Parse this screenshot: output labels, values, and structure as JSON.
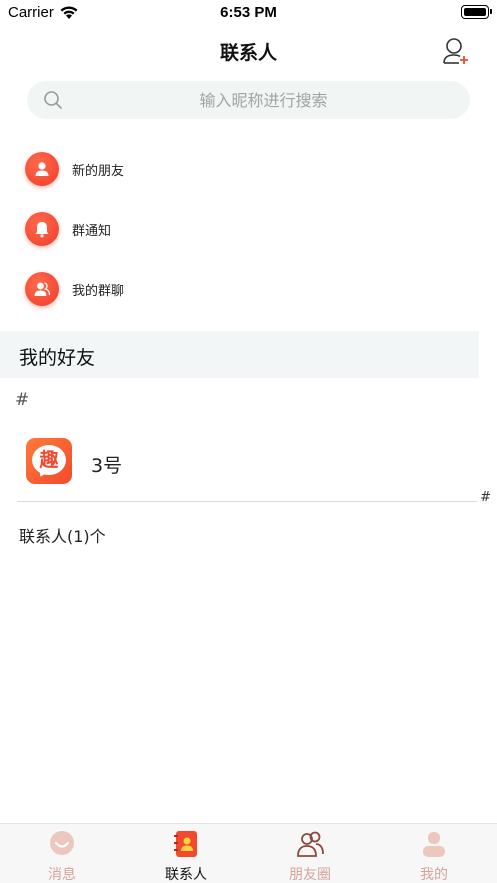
{
  "status_bar": {
    "carrier": "Carrier",
    "time": "6:53 PM"
  },
  "header": {
    "title": "联系人",
    "add_icon": "add-friend-icon"
  },
  "search": {
    "placeholder": "输入昵称进行搜索",
    "icon": "search-icon"
  },
  "functions": [
    {
      "label": "新的朋友",
      "icon": "person-icon"
    },
    {
      "label": "群通知",
      "icon": "bell-icon"
    },
    {
      "label": "我的群聊",
      "icon": "group-icon"
    }
  ],
  "section": {
    "title": "我的好友"
  },
  "index": {
    "letter": "#",
    "side_letter": "#"
  },
  "friends": [
    {
      "name": "3号",
      "avatar_glyph": "趣"
    }
  ],
  "contact_count": "联系人(1)个",
  "tabs": [
    {
      "label": "消息",
      "icon": "message-icon",
      "active": false
    },
    {
      "label": "联系人",
      "icon": "contacts-book-icon",
      "active": true
    },
    {
      "label": "朋友圈",
      "icon": "friends-circle-icon",
      "active": false
    },
    {
      "label": "我的",
      "icon": "profile-icon",
      "active": false
    }
  ],
  "colors": {
    "accent": "#f24a2c",
    "tab_inactive": "#d4a49a",
    "section_bg": "#f2f6f6",
    "search_bg": "#f1f6f5"
  }
}
